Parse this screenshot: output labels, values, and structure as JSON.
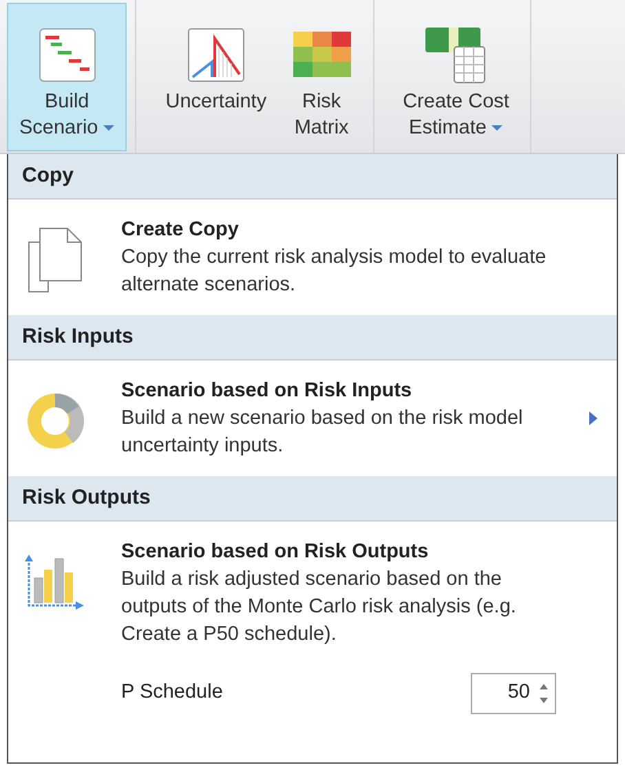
{
  "ribbon": {
    "groups": [
      {
        "buttons": [
          {
            "kind": "gantt",
            "lines": [
              "Build",
              "Scenario"
            ],
            "dropdown": true,
            "selected": true
          }
        ]
      },
      {
        "buttons": [
          {
            "kind": "uncertainty",
            "lines": [
              "Uncertainty"
            ],
            "dropdown": false,
            "selected": false
          },
          {
            "kind": "matrix",
            "lines": [
              "Risk",
              "Matrix"
            ],
            "dropdown": false,
            "selected": false
          }
        ]
      },
      {
        "buttons": [
          {
            "kind": "cost",
            "lines": [
              "Create Cost",
              "Estimate"
            ],
            "dropdown": true,
            "selected": false
          }
        ]
      }
    ]
  },
  "menu": {
    "sections": [
      {
        "header": "Copy",
        "items": [
          {
            "kind": "copy",
            "title": "Create Copy",
            "description": "Copy the current risk analysis model to evaluate alternate scenarios.",
            "submenu": false
          }
        ]
      },
      {
        "header": "Risk Inputs",
        "items": [
          {
            "kind": "donut",
            "title": "Scenario based on Risk Inputs",
            "description": "Build a new scenario based on the risk model uncertainty inputs.",
            "submenu": true
          }
        ]
      },
      {
        "header": "Risk Outputs",
        "items": [
          {
            "kind": "bars",
            "title": "Scenario based on Risk Outputs",
            "description": "Build a risk adjusted scenario based on the outputs of the Monte Carlo risk analysis (e.g. Create a P50 schedule).",
            "submenu": false,
            "field": {
              "label": "P Schedule",
              "value": "50"
            }
          }
        ]
      }
    ]
  }
}
